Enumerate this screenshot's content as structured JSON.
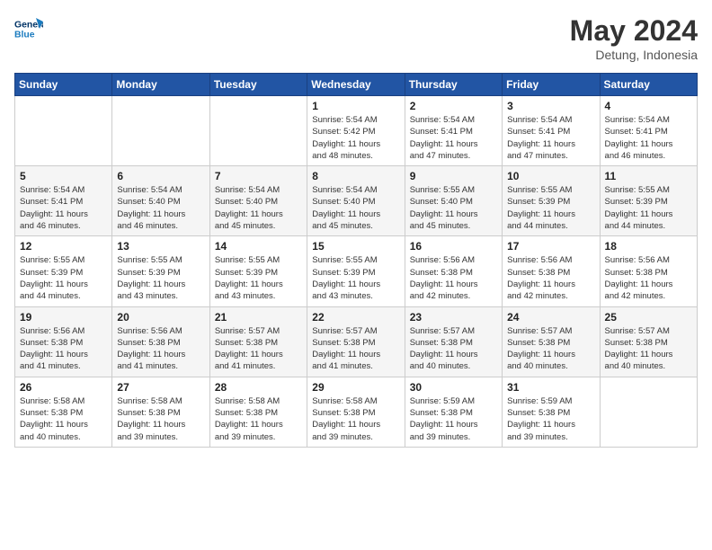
{
  "header": {
    "logo_line1": "General",
    "logo_line2": "Blue",
    "month_title": "May 2024",
    "location": "Detung, Indonesia"
  },
  "weekdays": [
    "Sunday",
    "Monday",
    "Tuesday",
    "Wednesday",
    "Thursday",
    "Friday",
    "Saturday"
  ],
  "weeks": [
    [
      {
        "day": "",
        "info": ""
      },
      {
        "day": "",
        "info": ""
      },
      {
        "day": "",
        "info": ""
      },
      {
        "day": "1",
        "info": "Sunrise: 5:54 AM\nSunset: 5:42 PM\nDaylight: 11 hours\nand 48 minutes."
      },
      {
        "day": "2",
        "info": "Sunrise: 5:54 AM\nSunset: 5:41 PM\nDaylight: 11 hours\nand 47 minutes."
      },
      {
        "day": "3",
        "info": "Sunrise: 5:54 AM\nSunset: 5:41 PM\nDaylight: 11 hours\nand 47 minutes."
      },
      {
        "day": "4",
        "info": "Sunrise: 5:54 AM\nSunset: 5:41 PM\nDaylight: 11 hours\nand 46 minutes."
      }
    ],
    [
      {
        "day": "5",
        "info": "Sunrise: 5:54 AM\nSunset: 5:41 PM\nDaylight: 11 hours\nand 46 minutes."
      },
      {
        "day": "6",
        "info": "Sunrise: 5:54 AM\nSunset: 5:40 PM\nDaylight: 11 hours\nand 46 minutes."
      },
      {
        "day": "7",
        "info": "Sunrise: 5:54 AM\nSunset: 5:40 PM\nDaylight: 11 hours\nand 45 minutes."
      },
      {
        "day": "8",
        "info": "Sunrise: 5:54 AM\nSunset: 5:40 PM\nDaylight: 11 hours\nand 45 minutes."
      },
      {
        "day": "9",
        "info": "Sunrise: 5:55 AM\nSunset: 5:40 PM\nDaylight: 11 hours\nand 45 minutes."
      },
      {
        "day": "10",
        "info": "Sunrise: 5:55 AM\nSunset: 5:39 PM\nDaylight: 11 hours\nand 44 minutes."
      },
      {
        "day": "11",
        "info": "Sunrise: 5:55 AM\nSunset: 5:39 PM\nDaylight: 11 hours\nand 44 minutes."
      }
    ],
    [
      {
        "day": "12",
        "info": "Sunrise: 5:55 AM\nSunset: 5:39 PM\nDaylight: 11 hours\nand 44 minutes."
      },
      {
        "day": "13",
        "info": "Sunrise: 5:55 AM\nSunset: 5:39 PM\nDaylight: 11 hours\nand 43 minutes."
      },
      {
        "day": "14",
        "info": "Sunrise: 5:55 AM\nSunset: 5:39 PM\nDaylight: 11 hours\nand 43 minutes."
      },
      {
        "day": "15",
        "info": "Sunrise: 5:55 AM\nSunset: 5:39 PM\nDaylight: 11 hours\nand 43 minutes."
      },
      {
        "day": "16",
        "info": "Sunrise: 5:56 AM\nSunset: 5:38 PM\nDaylight: 11 hours\nand 42 minutes."
      },
      {
        "day": "17",
        "info": "Sunrise: 5:56 AM\nSunset: 5:38 PM\nDaylight: 11 hours\nand 42 minutes."
      },
      {
        "day": "18",
        "info": "Sunrise: 5:56 AM\nSunset: 5:38 PM\nDaylight: 11 hours\nand 42 minutes."
      }
    ],
    [
      {
        "day": "19",
        "info": "Sunrise: 5:56 AM\nSunset: 5:38 PM\nDaylight: 11 hours\nand 41 minutes."
      },
      {
        "day": "20",
        "info": "Sunrise: 5:56 AM\nSunset: 5:38 PM\nDaylight: 11 hours\nand 41 minutes."
      },
      {
        "day": "21",
        "info": "Sunrise: 5:57 AM\nSunset: 5:38 PM\nDaylight: 11 hours\nand 41 minutes."
      },
      {
        "day": "22",
        "info": "Sunrise: 5:57 AM\nSunset: 5:38 PM\nDaylight: 11 hours\nand 41 minutes."
      },
      {
        "day": "23",
        "info": "Sunrise: 5:57 AM\nSunset: 5:38 PM\nDaylight: 11 hours\nand 40 minutes."
      },
      {
        "day": "24",
        "info": "Sunrise: 5:57 AM\nSunset: 5:38 PM\nDaylight: 11 hours\nand 40 minutes."
      },
      {
        "day": "25",
        "info": "Sunrise: 5:57 AM\nSunset: 5:38 PM\nDaylight: 11 hours\nand 40 minutes."
      }
    ],
    [
      {
        "day": "26",
        "info": "Sunrise: 5:58 AM\nSunset: 5:38 PM\nDaylight: 11 hours\nand 40 minutes."
      },
      {
        "day": "27",
        "info": "Sunrise: 5:58 AM\nSunset: 5:38 PM\nDaylight: 11 hours\nand 39 minutes."
      },
      {
        "day": "28",
        "info": "Sunrise: 5:58 AM\nSunset: 5:38 PM\nDaylight: 11 hours\nand 39 minutes."
      },
      {
        "day": "29",
        "info": "Sunrise: 5:58 AM\nSunset: 5:38 PM\nDaylight: 11 hours\nand 39 minutes."
      },
      {
        "day": "30",
        "info": "Sunrise: 5:59 AM\nSunset: 5:38 PM\nDaylight: 11 hours\nand 39 minutes."
      },
      {
        "day": "31",
        "info": "Sunrise: 5:59 AM\nSunset: 5:38 PM\nDaylight: 11 hours\nand 39 minutes."
      },
      {
        "day": "",
        "info": ""
      }
    ]
  ]
}
